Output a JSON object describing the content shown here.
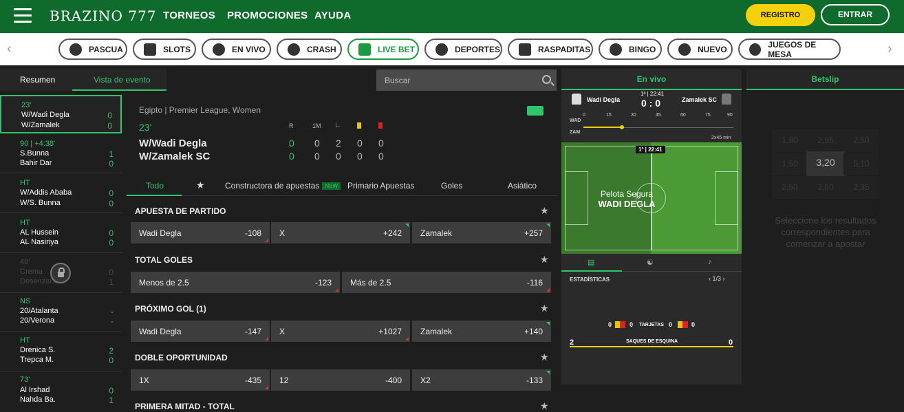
{
  "brand": {
    "logo": "BRAZINO 777"
  },
  "topnav": [
    "TORNEOS",
    "PROMOCIONES",
    "AYUDA"
  ],
  "auth": {
    "register": "REGISTRO",
    "login": "ENTRAR"
  },
  "categories": [
    "PASCUA",
    "SLOTS",
    "EN VIVO",
    "CRASH",
    "LIVE BET",
    "DEPORTES",
    "RASPADITAS",
    "BINGO",
    "NUEVO",
    "JUEGOS DE MESA"
  ],
  "left_tabs": {
    "summary": "Resumen",
    "event_view": "Vista de evento"
  },
  "search": {
    "placeholder": "Buscar"
  },
  "matches": [
    {
      "status": "23'",
      "team1": "W/Wadi Degla",
      "team2": "W/Zamalek",
      "s1": "0",
      "s2": "0"
    },
    {
      "status": "90  |  +4:38'",
      "team1": "S.Bunna",
      "team2": "Bahir Dar",
      "s1": "1",
      "s2": "0"
    },
    {
      "status": "HT",
      "team1": "W/Addis Ababa",
      "team2": "W/S. Bunna",
      "s1": "0",
      "s2": "0"
    },
    {
      "status": "HT",
      "team1": "AL Hussein",
      "team2": "AL Nasiriya",
      "s1": "0",
      "s2": "0"
    },
    {
      "status": "48'",
      "team1": "Crema",
      "team2": "Desenzano",
      "s1": "0",
      "s2": "1"
    },
    {
      "status": "NS",
      "team1": "20/Atalanta",
      "team2": "20/Verona",
      "s1": "-",
      "s2": "-"
    },
    {
      "status": "HT",
      "team1": "Drenica S.",
      "team2": "Trepca M.",
      "s1": "2",
      "s2": "0"
    },
    {
      "status": "73'",
      "team1": "Al Irshad",
      "team2": "Nahda Ba.",
      "s1": "0",
      "s2": "1"
    }
  ],
  "event": {
    "league": "Egipto | Premier League, Women",
    "minute": "23'",
    "team1": "W/Wadi Degla",
    "team2": "W/Zamalek SC",
    "col_r": "R",
    "col_1m": "1M",
    "row1": [
      "0",
      "0",
      "2",
      "0",
      "0"
    ],
    "row2": [
      "0",
      "0",
      "0",
      "0",
      "0"
    ]
  },
  "market_tabs": [
    "Todo",
    "Constructora de apuestas",
    "Primario Apuestas",
    "Goles",
    "Asiático"
  ],
  "new_badge": "NEW",
  "markets": [
    {
      "title": "APUESTA DE PARTIDO",
      "odds": [
        [
          "Wadi Degla",
          "-108"
        ],
        [
          "X",
          "+242"
        ],
        [
          "Zamalek",
          "+257"
        ]
      ]
    },
    {
      "title": "TOTAL GOLES",
      "odds": [
        [
          "Menos de 2.5",
          "-123"
        ],
        [
          "Más de 2.5",
          "-116"
        ]
      ]
    },
    {
      "title": "PRÓXIMO GOL (1)",
      "odds": [
        [
          "Wadi Degla",
          "-147"
        ],
        [
          "X",
          "+1027"
        ],
        [
          "Zamalek",
          "+140"
        ]
      ]
    },
    {
      "title": "DOBLE OPORTUNIDAD",
      "odds": [
        [
          "1X",
          "-435"
        ],
        [
          "12",
          "-400"
        ],
        [
          "X2",
          "-133"
        ]
      ]
    },
    {
      "title": "PRIMERA MITAD - TOTAL",
      "odds": []
    }
  ],
  "live": {
    "header": "En vivo",
    "home": "Wadi Degla",
    "away": "Zamalek SC",
    "clock": "1ª | 22:41",
    "score": "0 : 0",
    "ticks": [
      "0",
      "15",
      "30",
      "45",
      "60",
      "75",
      "90"
    ],
    "row_home": "WAD",
    "row_away": "ZAM",
    "duration": "2x45 min",
    "pitch_clock": "1ª | 22:41",
    "possession_label": "Pelota Segura",
    "possession_team": "WADI DEGLA",
    "stats_title": "ESTADÍSTICAS",
    "pager": "1/3",
    "cards_label": "TARJETAS",
    "cards": [
      "0",
      "0",
      "0",
      "0"
    ],
    "corners_label": "SAQUES DE ESQUINA",
    "corners_home": "2",
    "corners_away": "0"
  },
  "betslip": {
    "header": "Betslip",
    "grid": [
      "1,80",
      "2,95",
      "2,50",
      "1,50",
      "3,20",
      "5,10",
      "2,50",
      "2,80",
      "2,35"
    ],
    "message": "Seleccione los resultados correspondientes para comenzar a apostar"
  }
}
